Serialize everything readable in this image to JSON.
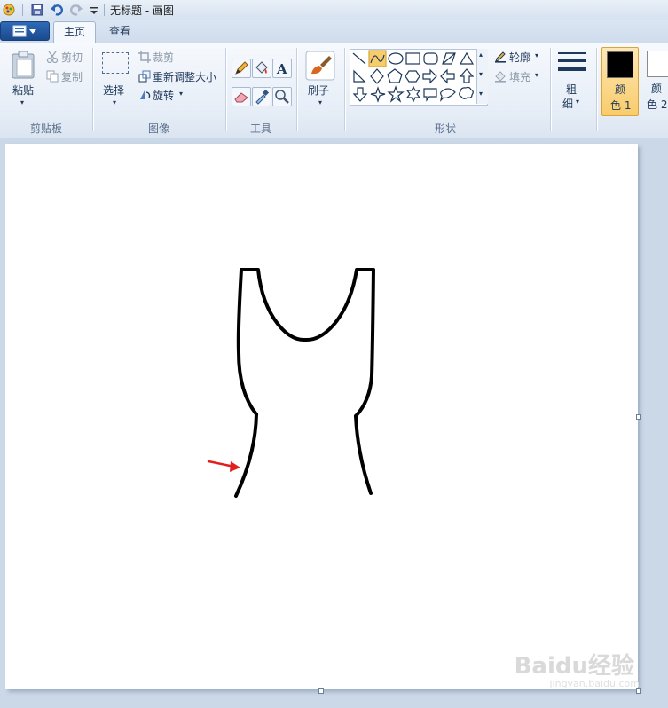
{
  "window": {
    "title": "无标题 - 画图"
  },
  "tabs": [
    {
      "label": "主页",
      "active": true
    },
    {
      "label": "查看",
      "active": false
    }
  ],
  "groups": {
    "clipboard": {
      "label": "剪贴板",
      "paste": "粘贴",
      "cut": "剪切",
      "copy": "复制"
    },
    "image": {
      "label": "图像",
      "select": "选择",
      "crop": "裁剪",
      "resize": "重新调整大小",
      "rotate": "旋转"
    },
    "tools": {
      "label": "工具"
    },
    "brushes": {
      "label": "刷子"
    },
    "shapes": {
      "label": "形状",
      "outline": "轮廓",
      "fill": "填充"
    },
    "size": {
      "line1": "粗",
      "line2": "细"
    },
    "colors": {
      "color1_line1": "颜",
      "color1_line2": "色 1",
      "color2_line1": "颜",
      "color2_line2": "色 2",
      "color1_value": "#000000",
      "color2_value": "#ffffff"
    }
  },
  "accent": "#f9cc6b",
  "annotation_color": "#e02020",
  "watermark": {
    "brand": "Baidu经验",
    "url": "jingyan.baidu.com"
  }
}
